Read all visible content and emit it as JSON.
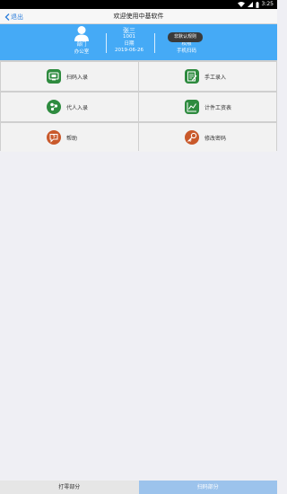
{
  "status_bar": {
    "time": "3:25"
  },
  "nav": {
    "back_label": "退出",
    "title": "欢迎使用中基软件"
  },
  "header": {
    "dept_label": "部门",
    "dept_value": "办公室",
    "user_name": "张三",
    "user_id": "1001",
    "date_label": "日期",
    "date_value": "2019-06-26",
    "scan_mode_label": "权限",
    "scan_mode_value": "手机扫码",
    "toast": "非默认规则"
  },
  "menu": {
    "scan_entry": "扫码入录",
    "manual_entry": "手工录入",
    "proxy_entry": "代人入录",
    "piecework_wage": "计件工资表",
    "help": "帮助",
    "change_password": "修改密码"
  },
  "tabs": {
    "tab1": "打零部分",
    "tab2": "扫码部分"
  },
  "colors": {
    "header_blue": "#45aaf6",
    "icon_green": "#2e8b3f",
    "icon_orange": "#c9592b",
    "tab_active": "#9cc3ec"
  }
}
